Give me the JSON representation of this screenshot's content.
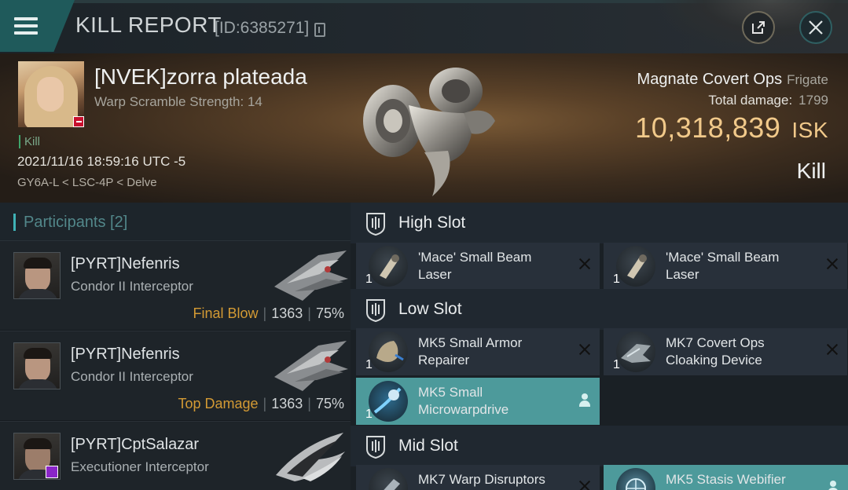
{
  "header": {
    "title": "KILL REPORT",
    "id_label": "[ID:6385271]",
    "menu_icon": "hamburger-icon",
    "share_icon": "external-link-icon",
    "close_icon": "close-icon"
  },
  "victim": {
    "name": "[NVEK]zorra plateada",
    "warp_scramble": "Warp Scramble Strength: 14",
    "kill_tag": "Kill",
    "datetime": "2021/11/16 18:59:16 UTC -5",
    "location": "GY6A-L < LSC-4P < Delve",
    "ship": "Magnate Covert Ops",
    "ship_class": "Frigate",
    "total_damage_label": "Total damage:",
    "total_damage": "1799",
    "isk_value": "10,318,839",
    "isk_unit": "ISK",
    "result": "Kill"
  },
  "participants": {
    "label": "Participants [2]",
    "items": [
      {
        "name": "[PYRT]Nefenris",
        "ship": "Condor II Interceptor",
        "tag": "Final Blow",
        "damage": "1363",
        "percent": "75%"
      },
      {
        "name": "[PYRT]Nefenris",
        "ship": "Condor II Interceptor",
        "tag": "Top Damage",
        "damage": "1363",
        "percent": "75%"
      },
      {
        "name": "[PYRT]CptSalazar",
        "ship": "Executioner Interceptor",
        "tag": "",
        "damage": "",
        "percent": ""
      }
    ]
  },
  "slots": {
    "high": {
      "label": "High Slot",
      "modules": [
        {
          "qty": "1",
          "name": "'Mace' Small Beam Laser"
        },
        {
          "qty": "1",
          "name": "'Mace' Small Beam Laser"
        }
      ]
    },
    "low": {
      "label": "Low Slot",
      "modules": [
        {
          "qty": "1",
          "name": "MK5 Small Armor Repairer"
        },
        {
          "qty": "1",
          "name": "MK7 Covert Ops Cloaking Device"
        },
        {
          "qty": "1",
          "name": "MK5 Small Microwarpdrive"
        }
      ]
    },
    "mid": {
      "label": "Mid Slot",
      "modules": [
        {
          "qty": "",
          "name": "MK7 Warp Disruptors"
        },
        {
          "qty": "",
          "name": "MK5 Stasis Webifier"
        }
      ]
    }
  },
  "colors": {
    "accent_teal": "#4d9a9b",
    "isk_gold": "#f1c98a",
    "tag_orange": "#d39a34"
  }
}
